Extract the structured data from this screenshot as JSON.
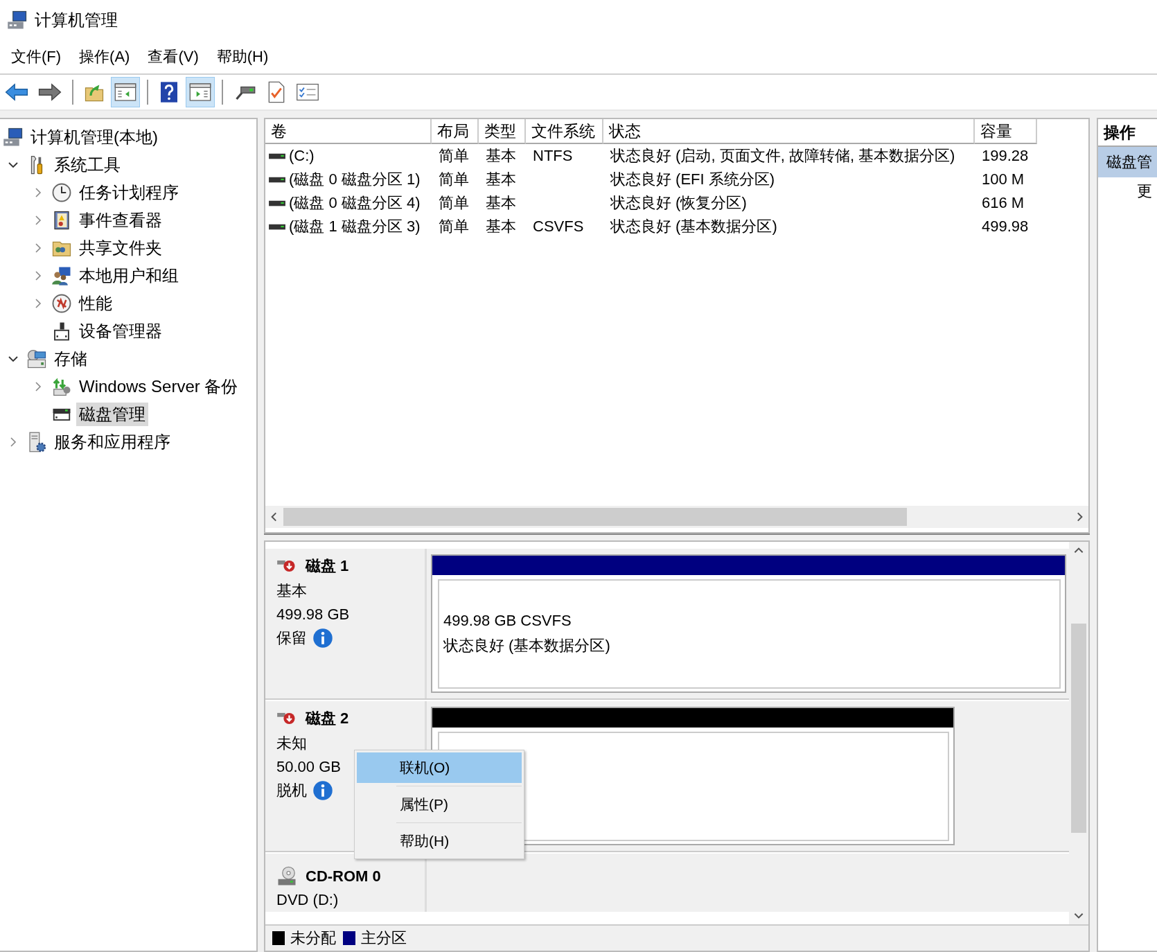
{
  "window": {
    "title": "计算机管理"
  },
  "menu": [
    "文件(F)",
    "操作(A)",
    "查看(V)",
    "帮助(H)"
  ],
  "toolbar": [
    {
      "kind": "back",
      "pressed": false
    },
    {
      "kind": "forward",
      "pressed": false
    },
    {
      "kind": "sep"
    },
    {
      "kind": "up",
      "pressed": false
    },
    {
      "kind": "tree",
      "pressed": true
    },
    {
      "kind": "sep"
    },
    {
      "kind": "help",
      "pressed": false
    },
    {
      "kind": "actions",
      "pressed": true
    },
    {
      "kind": "sep"
    },
    {
      "kind": "connect",
      "pressed": false
    },
    {
      "kind": "check",
      "pressed": false
    },
    {
      "kind": "list",
      "pressed": false
    }
  ],
  "tree": [
    {
      "label": "计算机管理(本地)",
      "kind": "computer",
      "expander": false,
      "selected": false,
      "children": [
        {
          "label": "系统工具",
          "kind": "tools",
          "expander": true,
          "expanded": true,
          "selected": false,
          "children": [
            {
              "label": "任务计划程序",
              "kind": "clock",
              "expander": true,
              "expanded": false,
              "selected": false
            },
            {
              "label": "事件查看器",
              "kind": "event",
              "expander": true,
              "expanded": false,
              "selected": false
            },
            {
              "label": "共享文件夹",
              "kind": "share",
              "expander": true,
              "expanded": false,
              "selected": false
            },
            {
              "label": "本地用户和组",
              "kind": "users",
              "expander": true,
              "expanded": false,
              "selected": false
            },
            {
              "label": "性能",
              "kind": "perf",
              "expander": true,
              "expanded": false,
              "selected": false
            },
            {
              "label": "设备管理器",
              "kind": "device",
              "expander": false,
              "selected": false
            }
          ]
        },
        {
          "label": "存储",
          "kind": "storage",
          "expander": true,
          "expanded": true,
          "selected": false,
          "children": [
            {
              "label": "Windows Server 备份",
              "kind": "backup",
              "expander": true,
              "expanded": false,
              "selected": false
            },
            {
              "label": "磁盘管理",
              "kind": "disk",
              "expander": false,
              "selected": true
            }
          ]
        },
        {
          "label": "服务和应用程序",
          "kind": "services",
          "expander": true,
          "expanded": false,
          "selected": false
        }
      ]
    }
  ],
  "volumes": {
    "columns": [
      "卷",
      "布局",
      "类型",
      "文件系统",
      "状态",
      "容量"
    ],
    "rows": [
      {
        "cells": [
          "(C:)",
          "简单",
          "基本",
          "NTFS",
          "状态良好 (启动, 页面文件, 故障转储, 基本数据分区)",
          "199.28"
        ]
      },
      {
        "cells": [
          "(磁盘 0 磁盘分区 1)",
          "简单",
          "基本",
          "",
          "状态良好 (EFI 系统分区)",
          "100 M"
        ]
      },
      {
        "cells": [
          "(磁盘 0 磁盘分区 4)",
          "简单",
          "基本",
          "",
          "状态良好 (恢复分区)",
          "616 M"
        ]
      },
      {
        "cells": [
          "(磁盘 1 磁盘分区 3)",
          "简单",
          "基本",
          "CSVFS",
          "状态良好 (基本数据分区)",
          "499.98"
        ]
      }
    ]
  },
  "disks": [
    {
      "kind": "disk",
      "name": "磁盘 1",
      "type": "基本",
      "size": "499.98 GB",
      "status": "保留",
      "partitions": [
        {
          "kind": "primary",
          "color": "#000080",
          "size": "499.98 GB CSVFS",
          "status": "状态良好 (基本数据分区)"
        }
      ]
    },
    {
      "kind": "disk",
      "name": "磁盘 2",
      "type": "未知",
      "size": "50.00 GB",
      "status": "脱机",
      "partitions": [
        {
          "kind": "unallocated",
          "color": "#000000"
        }
      ]
    },
    {
      "kind": "cdrom",
      "name": "CD-ROM 0",
      "type": "DVD (D:)"
    }
  ],
  "legend": [
    {
      "label": "未分配",
      "color": "#000000"
    },
    {
      "label": "主分区",
      "color": "#000080"
    }
  ],
  "context_menu": [
    {
      "label": "联机(O)",
      "selected": true
    },
    {
      "label": "属性(P)",
      "selected": false
    },
    {
      "label": "帮助(H)",
      "selected": false
    }
  ],
  "actions": {
    "title": "操作",
    "items": [
      {
        "kind": "header",
        "label": "磁盘管"
      },
      {
        "kind": "link",
        "label": "更"
      }
    ]
  }
}
